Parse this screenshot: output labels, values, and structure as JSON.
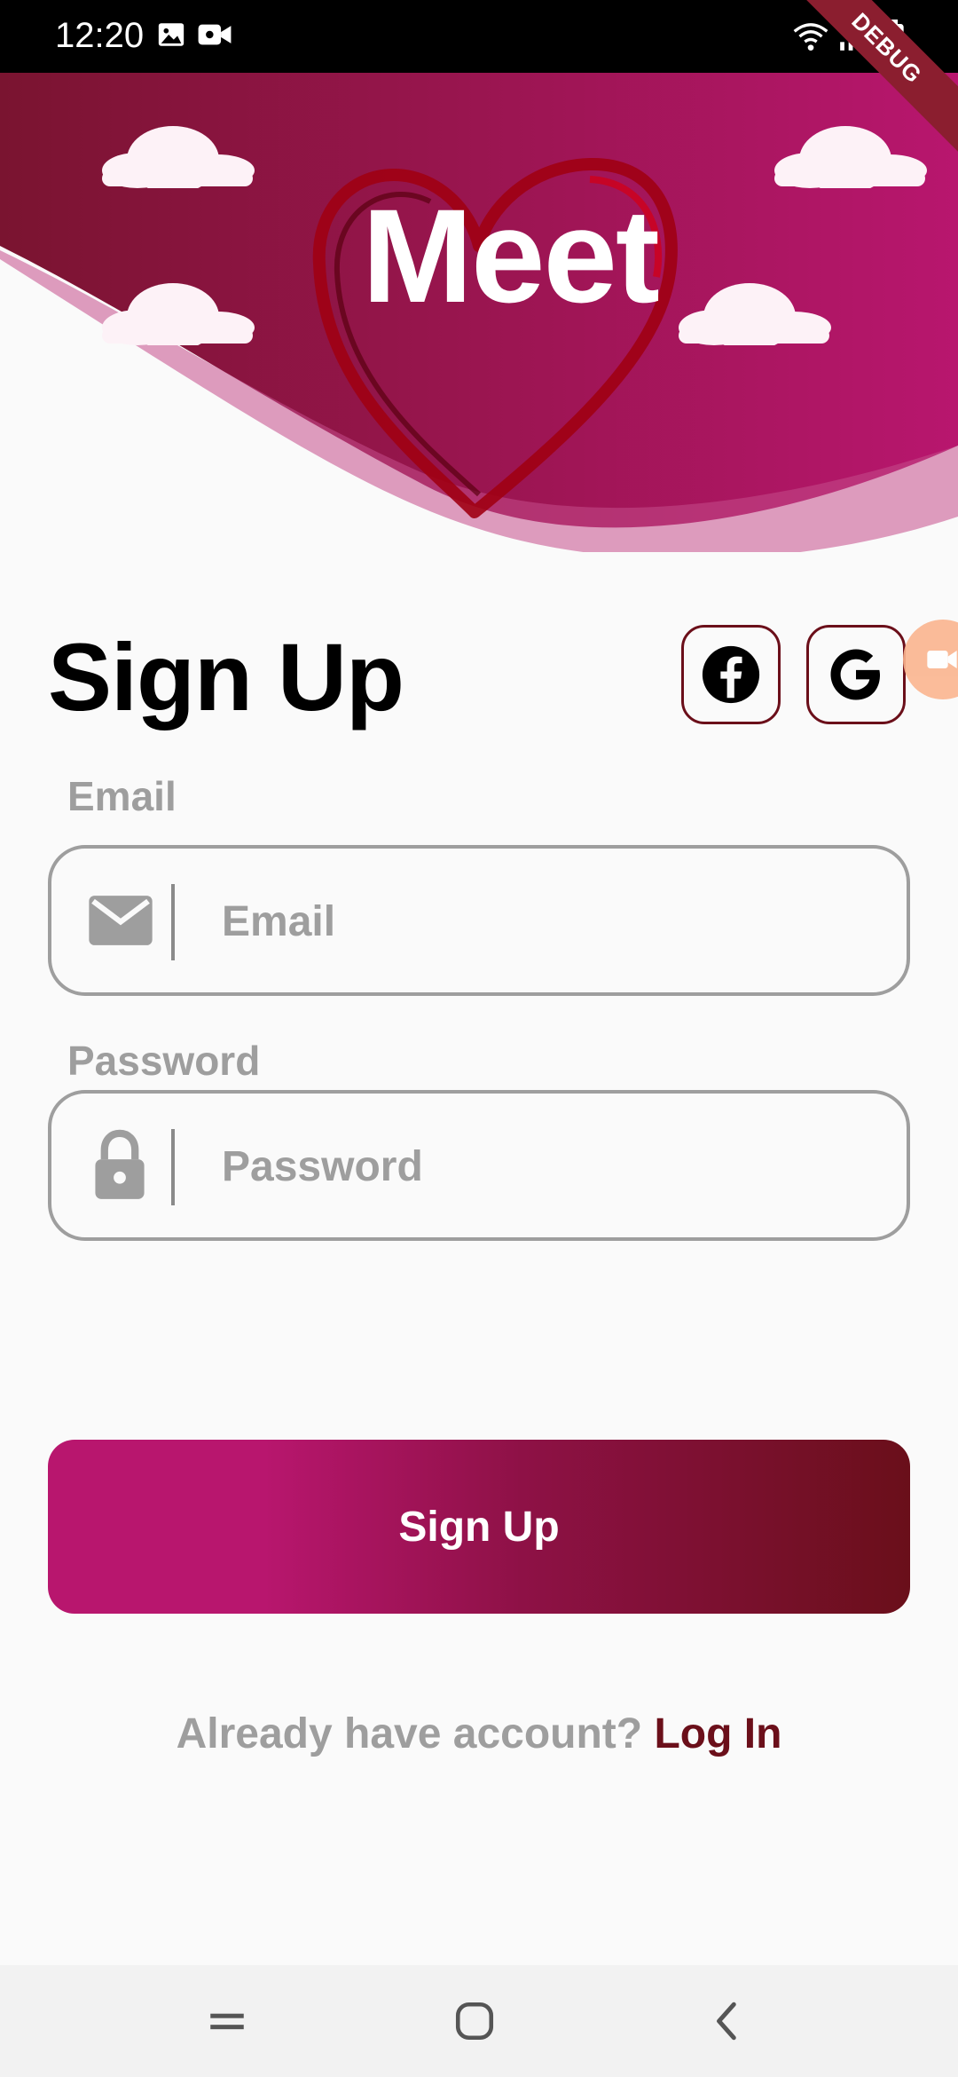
{
  "status_bar": {
    "time": "12:20",
    "icons": [
      "image-icon",
      "video-icon",
      "wifi-icon",
      "signal-icon",
      "battery-icon"
    ],
    "debug_banner": "DEBUG"
  },
  "header": {
    "logo_text": "Meet",
    "colors": {
      "gradient_start": "#7a1430",
      "gradient_end": "#b8166e"
    }
  },
  "form": {
    "title": "Sign Up",
    "social": [
      {
        "name": "facebook",
        "icon": "facebook-icon"
      },
      {
        "name": "google",
        "icon": "google-icon"
      }
    ],
    "email": {
      "label": "Email",
      "placeholder": "Email",
      "value": "",
      "icon": "mail-icon"
    },
    "password": {
      "label": "Password",
      "placeholder": "Password",
      "value": "",
      "icon": "lock-icon"
    },
    "submit_label": "Sign Up",
    "login_prompt": "Already have account?",
    "login_link": "Log In"
  },
  "colors": {
    "accent": "#6b0f1a",
    "button_gradient_start": "#b8166e",
    "button_gradient_end": "#6a0f1a",
    "muted": "#9e9e9e"
  },
  "nav_bar": {
    "buttons": [
      "recents-icon",
      "home-icon",
      "back-icon"
    ]
  }
}
